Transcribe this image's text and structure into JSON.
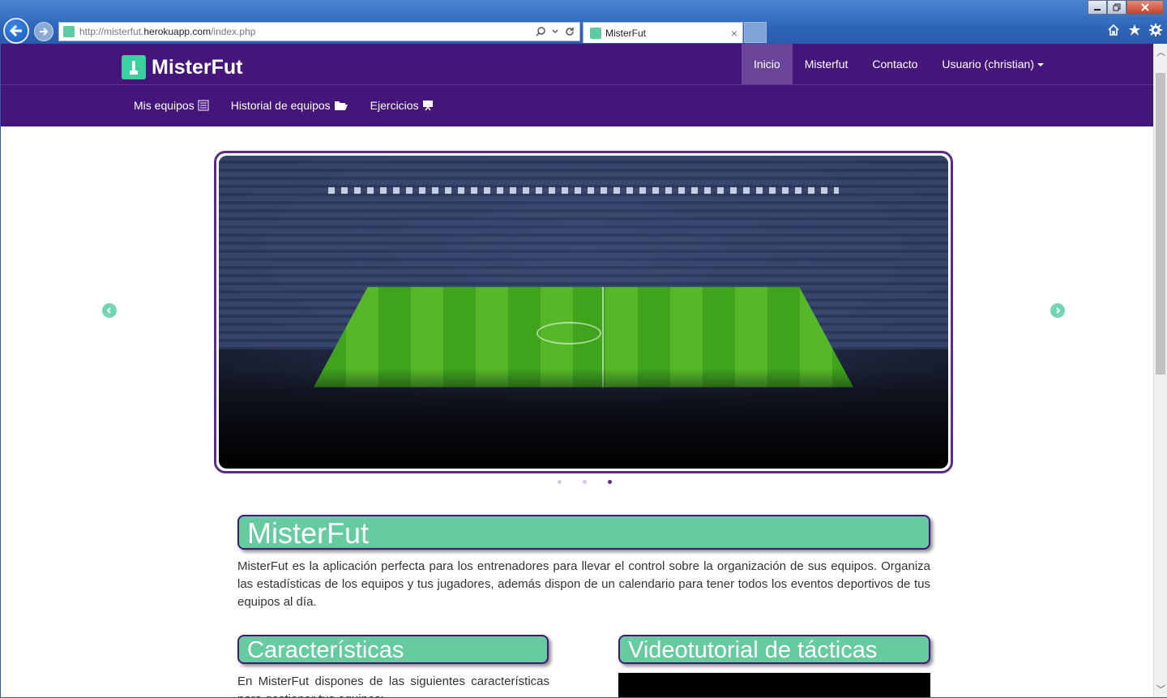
{
  "browser": {
    "url_prefix": "http://misterfut.",
    "url_domain": "herokuapp.com",
    "url_suffix": "/index.php",
    "tab_title": "MisterFut",
    "tab_close": "×"
  },
  "navbar": {
    "brand": "MisterFut",
    "items": [
      {
        "label": "Inicio",
        "active": true
      },
      {
        "label": "Misterfut"
      },
      {
        "label": "Contacto"
      },
      {
        "label": "Usuario (christian)"
      }
    ],
    "sub_items": [
      {
        "label": "Mis equipos",
        "icon": "list-icon"
      },
      {
        "label": "Historial de equipos",
        "icon": "folder-open-icon"
      },
      {
        "label": "Ejercicios",
        "icon": "board-icon"
      }
    ]
  },
  "carousel": {
    "slide_count": 3,
    "active_index": 2,
    "image": "stadium-photo"
  },
  "main": {
    "title": "MisterFut",
    "intro": "MisterFut es la aplicación perfecta para los entrenadores para llevar el control sobre la organización de sus equipos. Organiza las estadísticas de los equipos y tus jugadores, además dispon de un calendario para tener todos los eventos deportivos de tus equipos al día.",
    "features_title": "Características",
    "features_intro": "En MisterFut dispones de las siguientes características para gestionar tus equipos:",
    "video_title": "Videotutorial de tácticas"
  },
  "colors": {
    "navbar": "#45167a",
    "accent": "#66cc9f",
    "active_nav": "#6a4498"
  }
}
